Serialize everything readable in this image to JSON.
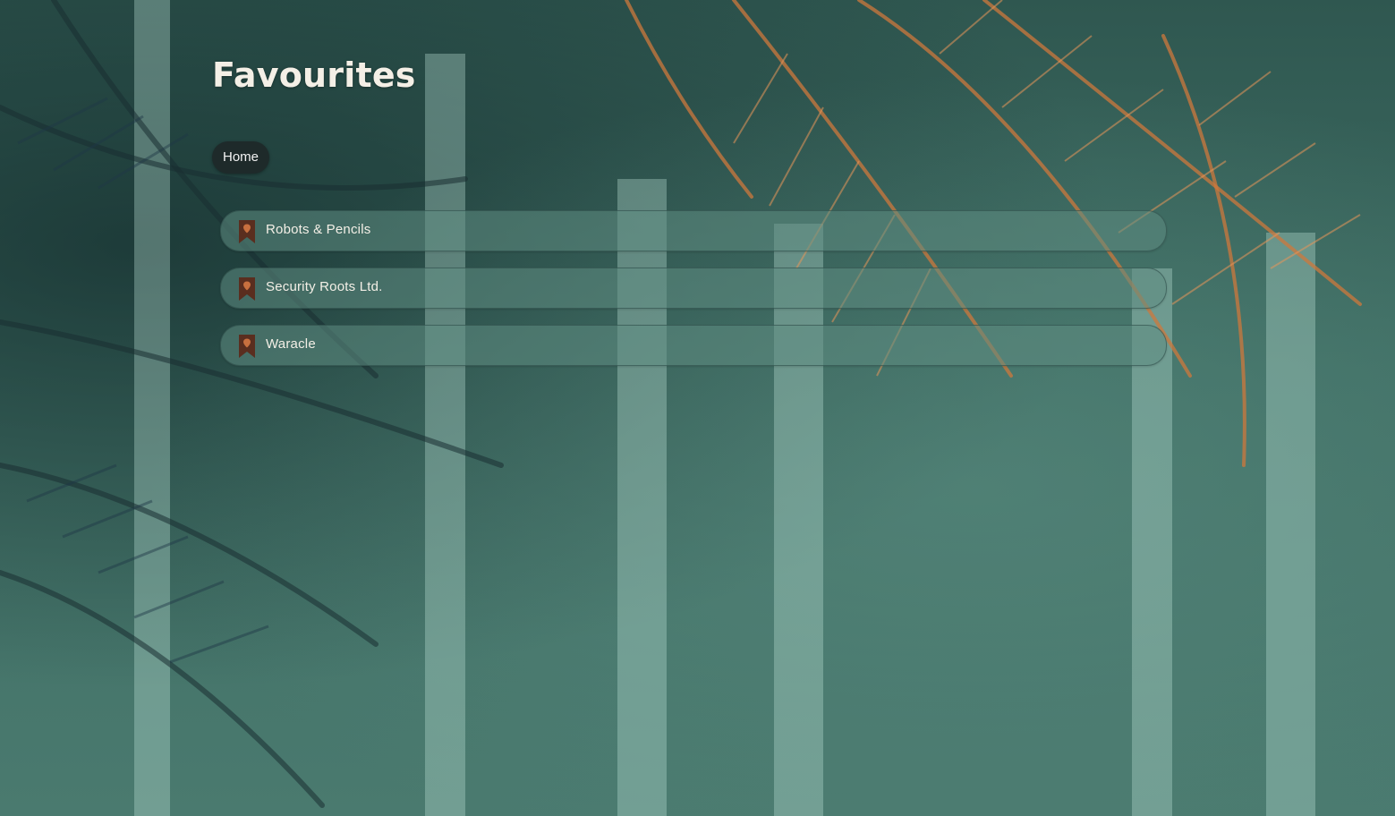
{
  "page": {
    "title": "Favourites"
  },
  "nav": {
    "home_label": "Home"
  },
  "favourites": [
    {
      "label": "Robots & Pencils",
      "icon": "bookmark-icon"
    },
    {
      "label": "Security Roots Ltd.",
      "icon": "bookmark-icon"
    },
    {
      "label": "Waracle",
      "icon": "bookmark-icon"
    }
  ],
  "colors": {
    "background": "#3f6b61",
    "bookmark_icon": "#5a2e1f",
    "pill": "#1e2a2a",
    "text": "#f3efe6"
  }
}
